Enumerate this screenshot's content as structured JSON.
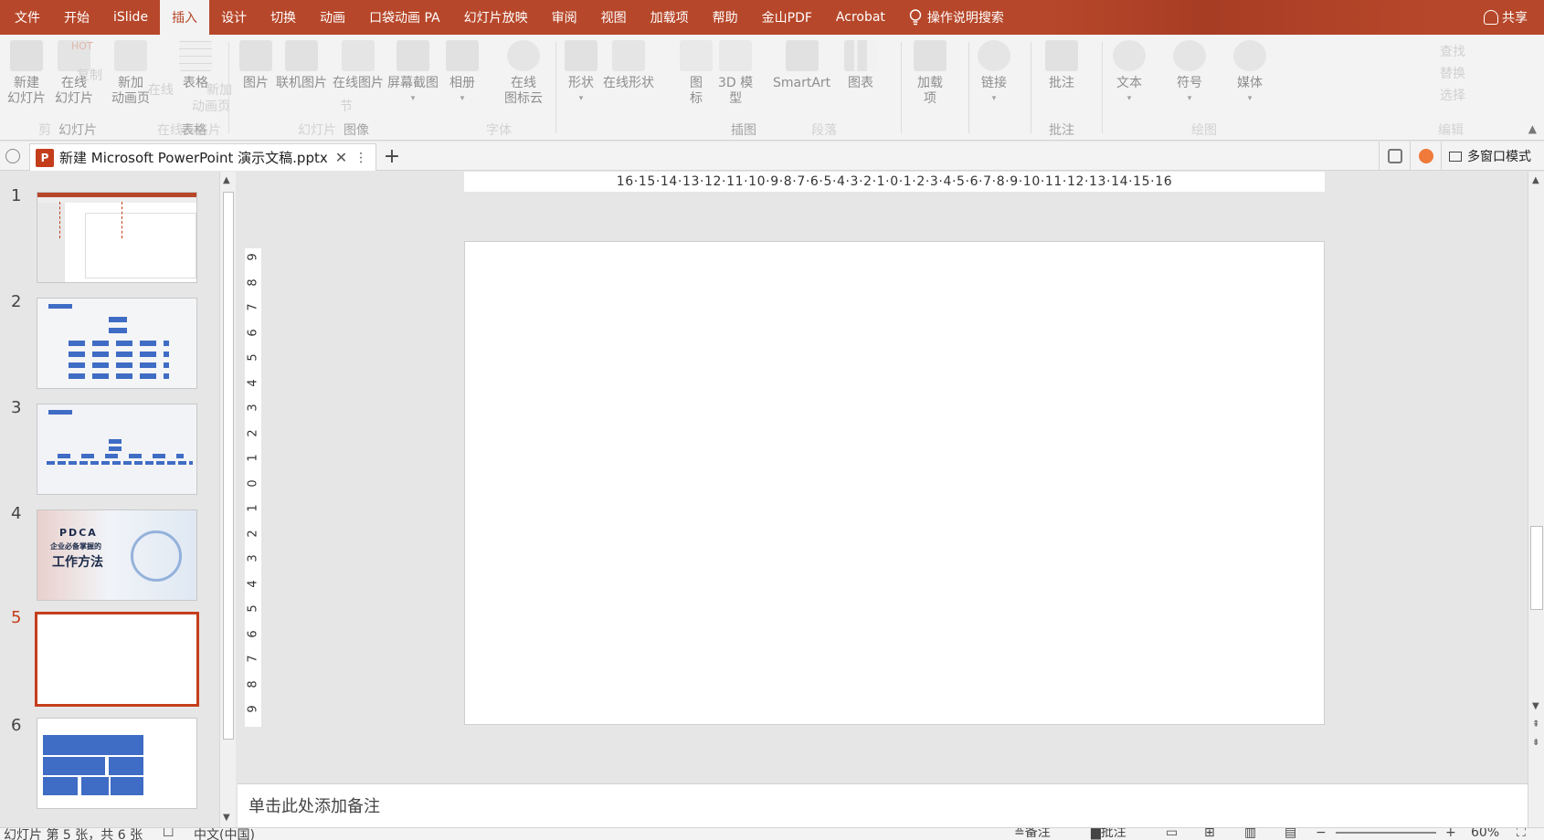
{
  "ribbon_tabs": [
    "文件",
    "开始",
    "iSlide",
    "插入",
    "设计",
    "切换",
    "动画",
    "口袋动画 PA",
    "幻灯片放映",
    "审阅",
    "视图",
    "加载项",
    "帮助",
    "金山PDF",
    "Acrobat",
    "操作说明搜索"
  ],
  "active_tab": "插入",
  "share_label": "共享",
  "ribbon": {
    "buttons": {
      "new_slide": [
        "新建",
        "幻灯片"
      ],
      "online_slide": [
        "在线",
        "幻灯片"
      ],
      "new_anim_page": [
        "新加",
        "动画页"
      ],
      "table": "表格",
      "picture": "图片",
      "online_picture_lib": "联机图片",
      "online_picture": "在线图片",
      "screenshot": "屏幕截图",
      "album": "相册",
      "online_icon_cloud": [
        "在线",
        "图标云"
      ],
      "shapes": "形状",
      "online_shapes": "在线形状",
      "icons": [
        "图",
        "标"
      ],
      "model3d": [
        "3D 模",
        "型"
      ],
      "smartart": "SmartArt",
      "chart": "图表",
      "addins": [
        "加载",
        "项"
      ],
      "link": "链接",
      "comment": "批注",
      "text": "文本",
      "symbol": "符号",
      "media": "媒体"
    },
    "ghost_text": {
      "hot": "HOT",
      "copy": "复制",
      "online_table": "在线",
      "new_anim_page2": "新加",
      "anim_page2": "动画页",
      "section": "节",
      "online_font": "在线",
      "find": "查找",
      "replace": "替换",
      "select": "选择"
    },
    "groups": {
      "slides": "幻灯片",
      "tables": "表格",
      "images": "图像",
      "illustrations": "插图",
      "comments": "批注",
      "ghost_clipboard": "剪",
      "ghost_table2": "在线表格片",
      "ghost_slide2": "幻灯片",
      "ghost_font": "字体",
      "ghost_paragraph": "段落",
      "ghost_draw": "绘图",
      "ghost_edit": "编辑"
    }
  },
  "document": {
    "tab_title": "新建 Microsoft PowerPoint 演示文稿.pptx",
    "multiwindow_label": "多窗口模式"
  },
  "thumbnails": [
    {
      "num": "1",
      "selected": false
    },
    {
      "num": "2",
      "selected": false
    },
    {
      "num": "3",
      "selected": false
    },
    {
      "num": "4",
      "selected": false,
      "title": "PDCA",
      "subtitle": "企业必备掌握的",
      "main": "工作方法"
    },
    {
      "num": "5",
      "selected": true
    },
    {
      "num": "6",
      "selected": false
    }
  ],
  "ruler": {
    "horizontal": "16·15·14·13·12·11·10·9·8·7·6·5·4·3·2·1·0·1·2·3·4·5·6·7·8·9·10·11·12·13·14·15·16",
    "vertical": [
      "9",
      "8",
      "7",
      "6",
      "5",
      "4",
      "3",
      "2",
      "1",
      "0",
      "1",
      "2",
      "3",
      "4",
      "5",
      "6",
      "7",
      "8",
      "9"
    ]
  },
  "notes_placeholder": "单击此处添加备注",
  "status": {
    "slide_info": "幻灯片 第 5 张，共 6 张",
    "language": "中文(中国)",
    "notes": "备注",
    "comments": "批注",
    "zoom_out": "−",
    "zoom_in": "+",
    "zoom": "60%"
  },
  "colors": {
    "accent": "#b7472a",
    "selection": "#c43e1c",
    "thumb_blue": "#3f6cc4"
  }
}
